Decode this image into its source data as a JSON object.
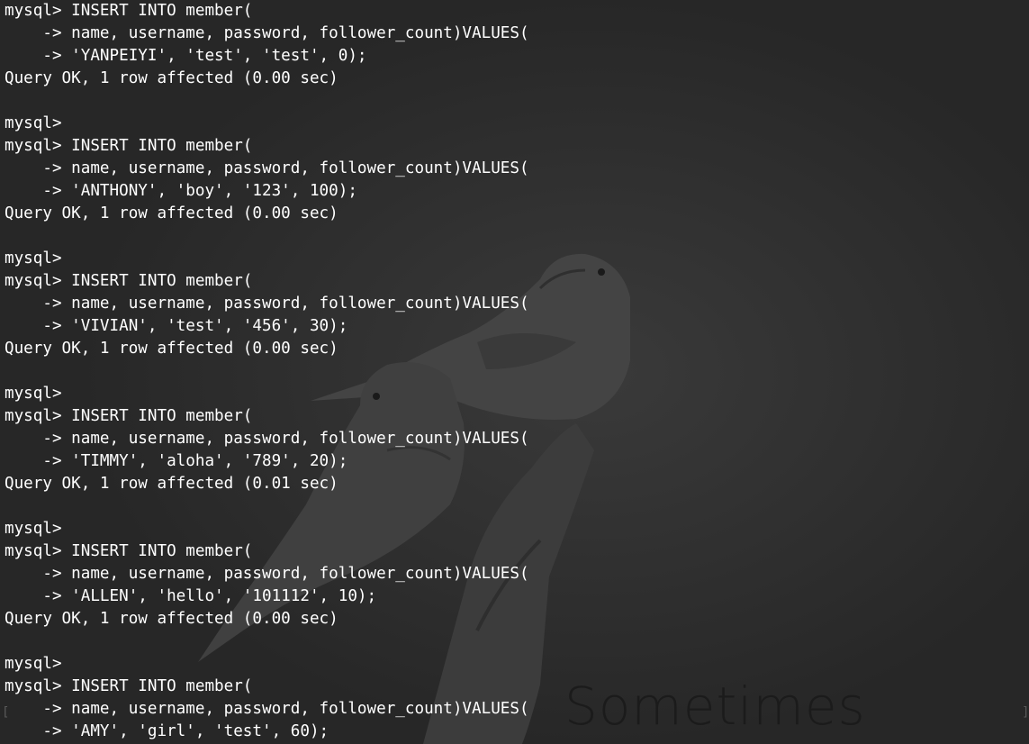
{
  "terminal": {
    "prompt": "mysql>",
    "wallpaper_caption": "Sometimes",
    "lines": [
      "mysql> INSERT INTO member(",
      "    -> name, username, password, follower_count)VALUES(",
      "    -> 'YANPEIYI', 'test', 'test', 0);",
      "Query OK, 1 row affected (0.00 sec)",
      "",
      "mysql>",
      "mysql> INSERT INTO member(",
      "    -> name, username, password, follower_count)VALUES(",
      "    -> 'ANTHONY', 'boy', '123', 100);",
      "Query OK, 1 row affected (0.00 sec)",
      "",
      "mysql>",
      "mysql> INSERT INTO member(",
      "    -> name, username, password, follower_count)VALUES(",
      "    -> 'VIVIAN', 'test', '456', 30);",
      "Query OK, 1 row affected (0.00 sec)",
      "",
      "mysql>",
      "mysql> INSERT INTO member(",
      "    -> name, username, password, follower_count)VALUES(",
      "    -> 'TIMMY', 'aloha', '789', 20);",
      "Query OK, 1 row affected (0.01 sec)",
      "",
      "mysql>",
      "mysql> INSERT INTO member(",
      "    -> name, username, password, follower_count)VALUES(",
      "    -> 'ALLEN', 'hello', '101112', 10);",
      "Query OK, 1 row affected (0.00 sec)",
      "",
      "mysql>",
      "mysql> INSERT INTO member(",
      "    -> name, username, password, follower_count)VALUES(",
      "    -> 'AMY', 'girl', 'test', 60);"
    ],
    "scroll_left_marker": "[",
    "scroll_right_marker": "]"
  }
}
